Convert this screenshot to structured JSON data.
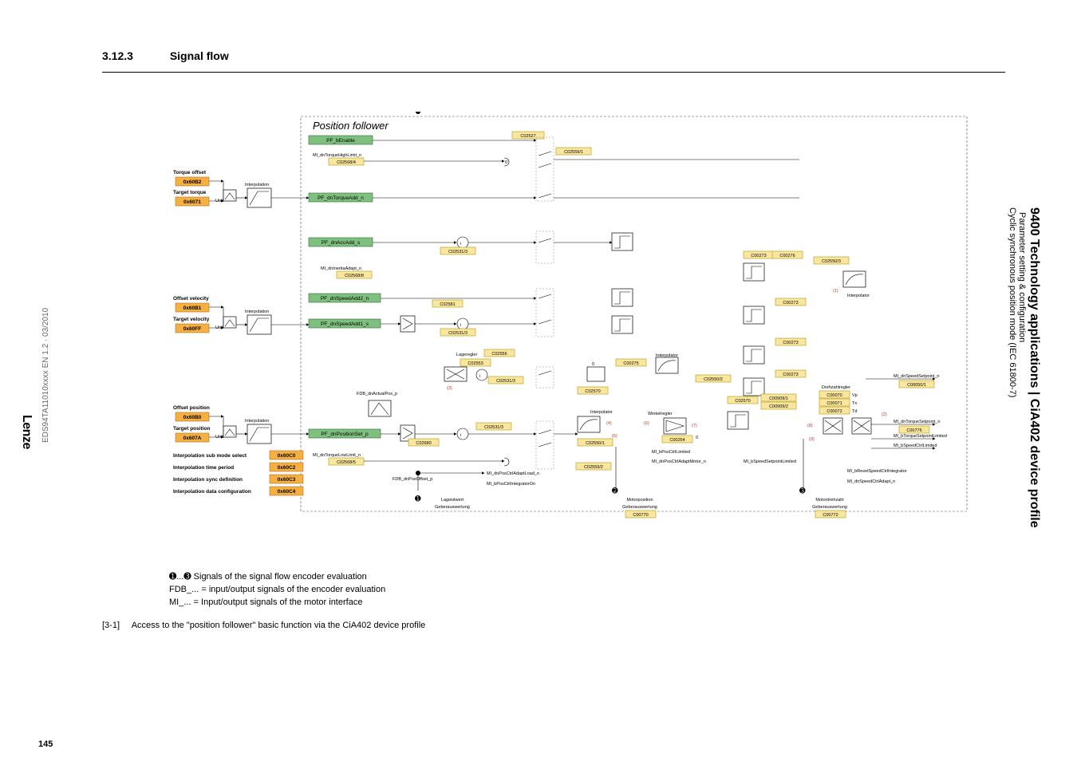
{
  "doc_ref": "EDS94TA11010xxxx EN 1.2 · 03/2010",
  "brand": "Lenze",
  "page_number": "145",
  "section": {
    "number": "3.12.3",
    "title": "Signal flow"
  },
  "right_header": {
    "line1": "9400 Technology applications | CiA402 device profile",
    "line2": "Parameter setting & configuration",
    "line3": "Cyclic synchronous position mode (IEC 61800-7)"
  },
  "diagram": {
    "title": "Position follower",
    "left_inputs": {
      "torque_offset": {
        "label": "Torque offset",
        "index": "0x60B2"
      },
      "target_torque": {
        "label": "Target torque",
        "index": "0x6071"
      },
      "offset_velocity": {
        "label": "Offset velocity",
        "index": "0x60B1"
      },
      "target_velocity": {
        "label": "Target velocity",
        "index": "0x60FF"
      },
      "offset_position": {
        "label": "Offset position",
        "index": "0x60B0"
      },
      "target_position": {
        "label": "Target position",
        "index": "0x607A"
      },
      "interp_sub_mode": {
        "label": "Interpolation sub mode select",
        "index": "0x60C0"
      },
      "interp_time_period": {
        "label": "Interpolation time period",
        "index": "0x60C2"
      },
      "interp_sync_def": {
        "label": "Interpolation sync definition",
        "index": "0x60C3"
      },
      "interp_data_cfg": {
        "label": "Interpolation data configuration",
        "index": "0x60C4"
      }
    },
    "interpolation_label": "Interpolation",
    "unit_label": "Unit",
    "pf_signals": {
      "pf_benable": "PF_bEnable",
      "pf_dntorqueadd": "PF_dnTorqueAdd_n",
      "pf_dnaccadd": "PF_dnAccAdd_s",
      "pf_dnspeedadd2": "PF_dnSpeedAdd2_n",
      "pf_dnspeedadd1": "PF_dnSpeedAdd1_s",
      "pf_dnpositionset": "PF_dnPositionSet_p",
      "ml_dntorquehigh": "MI_dnTorqueHighLimit_n",
      "ml_dntorquelow": "MI_dnTorqueLowLimit_n",
      "ml_dninertia": "MI_dnInertiaAdapt_n",
      "fdb_actualpos": "FDB_dnActualPos_p",
      "fdb_posoffset": "FDB_dnPosOffset_p",
      "ml_dnposctriload": "MI_dnPosCtrlAdaptLoad_n",
      "ml_bposctrlintegrator": "MI_bPosCtrlIntegratorOn",
      "ml_bposctrllimited": "MI_bPosCtrlLimited",
      "ml_dnposctradaptmotor": "MI_dnPosCtrlAdaptMotor_n",
      "ml_bspeedsetpointlimited": "MI_bSpeedSetpointLimited",
      "ml_dnspeedsetpoint": "MI_dnSpeedSetpoint_n",
      "ml_dntorquesetpoint": "MI_dnTorqueSetpoint_n",
      "ml_btorquesetpointlimited": "MI_bTorqueSetpointLimited",
      "ml_bspeedctrllimited": "MI_bSpeedCtrlLimited",
      "ml_bresetspeedctrlintegrator": "MI_bResetSpeedCtrlIntegrator",
      "ml_dnspeedctrladapt": "MI_dnSpeedCtrlAdapt_n"
    },
    "labels_de": {
      "lageregler": "Lageregler",
      "winkelregler": "Winkelregler",
      "interpolator": "Interpolator",
      "drehzahlregler": "Drehzahlregler",
      "lageistwert": "Lageistwert",
      "geberauswertung": "Geberauswertung",
      "motorposition": "Motorposition",
      "motordrehzahl": "Motordrehzahl"
    },
    "codes": {
      "c02527": "C02527",
      "c02559_1": "C02559/1",
      "c02559_2": "C02559/2",
      "c02568_4": "C02568/4",
      "c02568_5": "C02568/5",
      "c02568_8": "C02568/8",
      "c02531_3": "C02531/3",
      "c02581": "C02581",
      "c02556": "C02556",
      "c02553": "C02553",
      "c02680": "C02680",
      "c00273": "C00273",
      "c00275": "C00275",
      "c00276": "C00276",
      "c00254": "C00254",
      "c02550_1": "C02550/1",
      "c02550_2": "C02550/2",
      "c02550_3": "C02550/3",
      "c02570": "C02570",
      "c00070": "C00070",
      "c00071": "C00071",
      "c00072": "C00072",
      "vp": "Vp",
      "tn": "Tn",
      "td": "Td",
      "c00909_1": "C00909/1",
      "c00909_2": "C00909/2",
      "c00770": "C00770",
      "c00772": "C00772",
      "c00050_1": "C00050/1",
      "c00776": "C00776"
    },
    "nums": {
      "n1": "(1)",
      "n2": "(2)",
      "n3": "(3)",
      "n4": "(4)",
      "n5": "(5)",
      "n6": "(6)",
      "n7": "(7)",
      "n8": "(8)",
      "n9": "(9)"
    },
    "dots": {
      "d1": "➊",
      "d2": "➋",
      "d3": "➌"
    },
    "zero": "0"
  },
  "caption_lines": {
    "l1a": "➊...➌ Signals of the signal flow encoder evaluation",
    "l2": "FDB_... = input/output signals of the encoder evaluation",
    "l3": "MI_... = Input/output signals of the motor interface"
  },
  "figure_ref": {
    "tag": "[3-1]",
    "text": "Access to the \"position follower\" basic function via the CiA402 device profile"
  }
}
